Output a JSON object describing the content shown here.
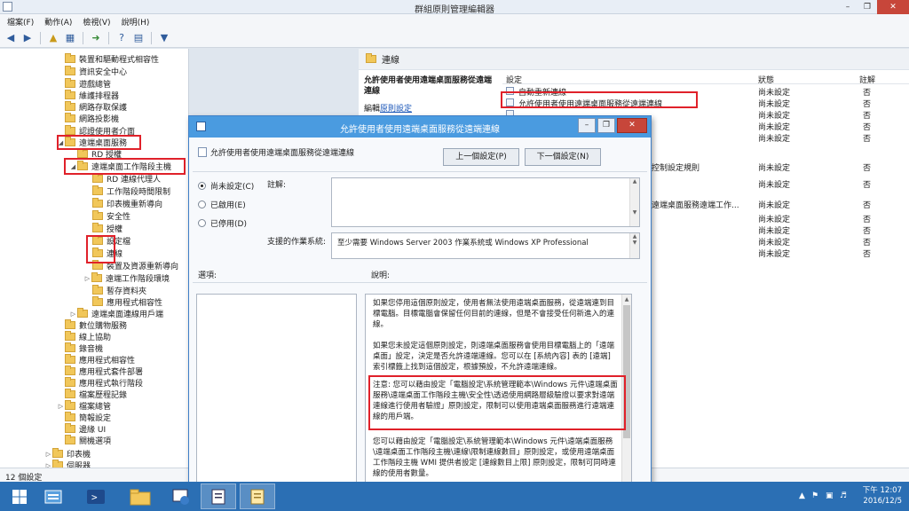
{
  "window": {
    "title": "群組原則管理編輯器"
  },
  "menu": [
    "檔案(F)",
    "動作(A)",
    "檢視(V)",
    "說明(H)"
  ],
  "toolbar_icons": [
    "back-icon",
    "forward-icon",
    "up-folder-icon",
    "show-hide-tree-icon",
    "export-icon",
    "help-icon",
    "properties-icon",
    "filter-icon"
  ],
  "tree": {
    "items": [
      "裝置和驅動程式相容性",
      "資訊安全中心",
      "遊戲總管",
      "維護排程器",
      "網路存取保護",
      "網路投影機",
      "認證使用者介面",
      "遠端桌面服務",
      "RD 授權",
      "遠端桌面工作階段主機",
      "RD 連線代理人",
      "工作階段時間限制",
      "印表機重新導向",
      "安全性",
      "授權",
      "設定檔",
      "連線",
      "裝置及資源重新導向",
      "遠端工作階段環境",
      "暫存資料夾",
      "應用程式相容性",
      "遠端桌面連線用戶端",
      "數位購物服務",
      "線上協助",
      "錄音機",
      "應用程式相容性",
      "應用程式套件部署",
      "應用程式執行階段",
      "檔案歷程記錄",
      "檔案總管",
      "簡報設定",
      "邊緣 UI",
      "關機選項",
      "印表機",
      "伺服器"
    ]
  },
  "status": {
    "count": "12 個設定"
  },
  "right": {
    "folder": "連線",
    "desc_title": "允許使用者使用遠端桌面服務從遠端連線",
    "edit_prefix": "編輯",
    "edit_link": "原則設定",
    "columns": {
      "setting": "設定",
      "state": "狀態",
      "comment": "註解"
    },
    "rows": [
      {
        "name": "自動重新連線",
        "state": "尚未設定",
        "comment": "否"
      },
      {
        "name": "允許使用者使用遠端桌面服務從遠端連線",
        "state": "尚未設定",
        "comment": "否"
      },
      {
        "name": "",
        "state": "尚未設定",
        "comment": "否"
      },
      {
        "name": "",
        "state": "尚未設定",
        "comment": "否"
      },
      {
        "name": "",
        "state": "尚未設定",
        "comment": "否"
      },
      {
        "name": "控制設定規則",
        "state": "尚未設定",
        "comment": "否"
      },
      {
        "name": "",
        "state": "尚未設定",
        "comment": "否"
      },
      {
        "name": "遠端桌面服務遠端工作...",
        "state": "尚未設定",
        "comment": "否"
      },
      {
        "name": "",
        "state": "尚未設定",
        "comment": "否"
      },
      {
        "name": "",
        "state": "尚未設定",
        "comment": "否"
      },
      {
        "name": "",
        "state": "尚未設定",
        "comment": "否"
      },
      {
        "name": "",
        "state": "尚未設定",
        "comment": "否"
      }
    ]
  },
  "dialog": {
    "title": "允許使用者使用遠端桌面服務從遠端連線",
    "heading": "允許使用者使用遠端桌面服務從遠端連線",
    "prev": "上一個設定(P)",
    "next": "下一個設定(N)",
    "opt_nc": "尚未設定(C)",
    "opt_en": "已啟用(E)",
    "opt_dis": "已停用(D)",
    "comment_label": "註解:",
    "supported_label": "支援的作業系統:",
    "supported": "至少需要 Windows Server 2003 作業系統或 Windows XP Professional",
    "options_label": "選項:",
    "help_label": "說明:",
    "help": [
      "如果您停用這個原則設定，使用者無法使用遠端桌面服務，從遠端連到目標電腦。目標電腦會保留任何目前的連線，但是不會接受任何新進入的連線。",
      "如果您未設定這個原則設定，則遠端桌面服務會使用目標電腦上的「遠端桌面」設定，決定是否允許遠端連線。您可以在 [系統內容] 表的 [遠端] 索引標籤上找到這個設定，根據預設，不允許遠端連線。",
      "注意: 您可以藉由設定「電腦設定\\系統管理範本\\Windows 元件\\遠端桌面服務\\遠端桌面工作階段主機\\安全性\\透過使用網路層級驗證以要求對遠端連線進行使用者驗證」原則設定，限制可以使用遠端桌面服務進行遠端連線的用戶端。",
      "您可以藉由設定「電腦設定\\系統管理範本\\Windows 元件\\遠端桌面服務\\遠端桌面工作階段主機\\連線\\限制連線數目」原則設定，或使用遠端桌面工作階段主機 WMI 提供者設定 [連線數目上限] 原則設定，限制可同時連線的使用者數量。"
    ]
  },
  "taskbar": {
    "time": "下午 12:07",
    "date": "2016/12/5",
    "apps": [
      "start-icon",
      "server-manager-icon",
      "powershell-icon",
      "file-explorer-icon",
      "group-policy-icon",
      "notepad-icon"
    ]
  },
  "colors": {
    "highlight": "#e0212a",
    "dialog_title": "#4a9be0",
    "taskbar": "#2b6fb4"
  }
}
